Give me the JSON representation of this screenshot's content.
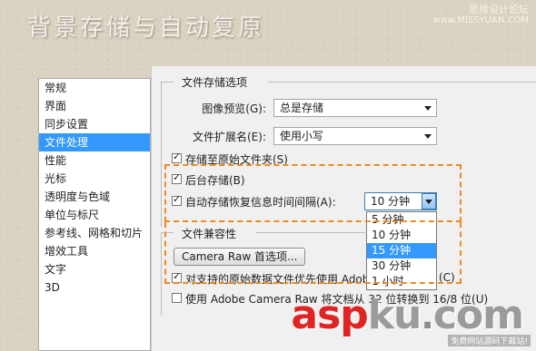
{
  "banner": {
    "title": "背景存储与自动复原",
    "site_label": "思缘设计论坛",
    "site_url": "www.MISSYUAN.COM"
  },
  "sidebar": {
    "items": [
      {
        "label": "常规",
        "selected": false
      },
      {
        "label": "界面",
        "selected": false
      },
      {
        "label": "同步设置",
        "selected": false
      },
      {
        "label": "文件处理",
        "selected": true
      },
      {
        "label": "性能",
        "selected": false
      },
      {
        "label": "光标",
        "selected": false
      },
      {
        "label": "透明度与色域",
        "selected": false
      },
      {
        "label": "单位与标尺",
        "selected": false
      },
      {
        "label": "参考线、网格和切片",
        "selected": false
      },
      {
        "label": "增效工具",
        "selected": false
      },
      {
        "label": "文字",
        "selected": false
      },
      {
        "label": "3D",
        "selected": false
      }
    ]
  },
  "file_save_options": {
    "group_title": "文件存储选项",
    "image_preview_label": "图像预览(G):",
    "image_preview_value": "总是存储",
    "file_extension_label": "文件扩展名(E):",
    "file_extension_value": "使用小写",
    "save_as_original_label": "存储至原始文件夹(S)",
    "save_as_original_checked": true,
    "background_save_label": "后台存储(B)",
    "background_save_checked": true,
    "auto_save_label": "自动存储恢复信息时间间隔(A):",
    "auto_save_checked": true,
    "auto_save_value": "10 分钟",
    "auto_save_options": [
      "5 分钟",
      "10 分钟",
      "15 分钟",
      "30 分钟",
      "1 小时"
    ],
    "auto_save_highlighted": "15 分钟"
  },
  "file_compat": {
    "group_title": "文件兼容性",
    "camera_raw_button": "Camera Raw 首选项...",
    "prefer_raw_label": "对支持的原始数据文件优先使用 Adob",
    "prefer_raw_suffix": "(C)",
    "prefer_raw_checked": true,
    "convert_label": "使用 Adobe Camera Raw 将文档从 32 位转换到 16/8 位(U)",
    "convert_checked": false
  },
  "watermark": {
    "logo_asp": "asp",
    "logo_ku": "ku",
    "logo_dot": ".",
    "logo_com": "com",
    "subtitle": "免费网站源码下载站!"
  },
  "colors": {
    "selection_blue": "#3399ff",
    "highlight_orange": "#f08a1c",
    "banner_bg": "#d9d2c1"
  }
}
